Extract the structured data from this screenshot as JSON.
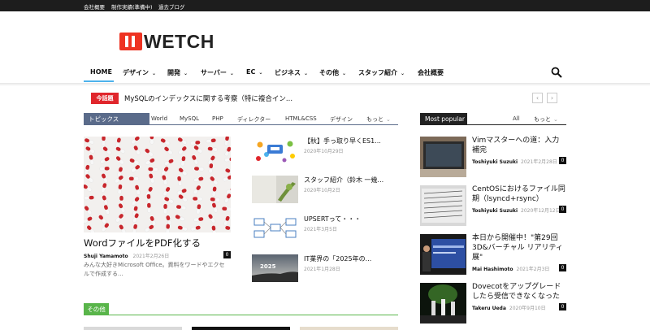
{
  "topbar": {
    "links": [
      "会社概要",
      "制作実績(準備中)",
      "過去ブログ"
    ]
  },
  "logo": {
    "text": "WETCH"
  },
  "nav": {
    "items": [
      {
        "label": "HOME",
        "dropdown": false
      },
      {
        "label": "デザイン",
        "dropdown": true
      },
      {
        "label": "開発",
        "dropdown": true
      },
      {
        "label": "サーバー",
        "dropdown": true
      },
      {
        "label": "EC",
        "dropdown": true
      },
      {
        "label": "ビジネス",
        "dropdown": true
      },
      {
        "label": "その他",
        "dropdown": true
      },
      {
        "label": "スタッフ紹介",
        "dropdown": true
      },
      {
        "label": "会社概要",
        "dropdown": false
      }
    ],
    "chevron": "⌄"
  },
  "ticker": {
    "badge": "今話題",
    "text": "MySQLのインデックスに関する考察（特に複合イン...",
    "prev": "‹",
    "next": "›"
  },
  "topics": {
    "label": "トピックス",
    "tabs": [
      "World",
      "MySQL",
      "PHP",
      "ディレクター",
      "HTML&CSS",
      "デザイン",
      "もっと"
    ]
  },
  "featured": {
    "title": "WordファイルをPDF化する",
    "author": "Shuji Yamamoto",
    "date": "2021年2月26日",
    "comments": "0",
    "excerpt": "みんな大好きMicrosoft Office。資料をワードやエクセルで作成する..."
  },
  "list": [
    {
      "title": "【秋】手っ取り早くES1...",
      "date": "2020年10月29日"
    },
    {
      "title": "スタッフ紹介（鈴木 一幾...",
      "date": "2020年10月2日"
    },
    {
      "title": "UPSERTって・・・",
      "date": "2021年3月5日"
    },
    {
      "title": "IT業界の「2025年の...",
      "date": "2021年1月28日",
      "thumb_text": "2025"
    }
  ],
  "popular": {
    "label": "Most popular",
    "tabs": [
      "All",
      "もっと"
    ],
    "items": [
      {
        "title": "Vimマスターへの道：入力補完",
        "author": "Toshiyuki Suzuki",
        "date": "2021年2月28日",
        "comments": "0"
      },
      {
        "title": "CentOSにおけるファイル同期（lsyncd+rsync）",
        "author": "Toshiyuki Suzuki",
        "date": "2020年12月12日",
        "comments": "0"
      },
      {
        "title": "本日から開催中！\"第29回 3D&バーチャル リアリティ展\"",
        "author": "Mai Hashimoto",
        "date": "2021年2月3日",
        "comments": "0"
      },
      {
        "title": "Dovecotをアップグレードしたら受信できなくなった",
        "author": "Takeru Ueda",
        "date": "2020年9月10日",
        "comments": "0"
      }
    ]
  },
  "section2": {
    "label": "その他"
  },
  "colors": {
    "topbar": "#1d1d1d",
    "accent": "#4db2ec",
    "badge": "#e0262c",
    "topics": "#5a6b8a",
    "other": "#59b54a"
  }
}
